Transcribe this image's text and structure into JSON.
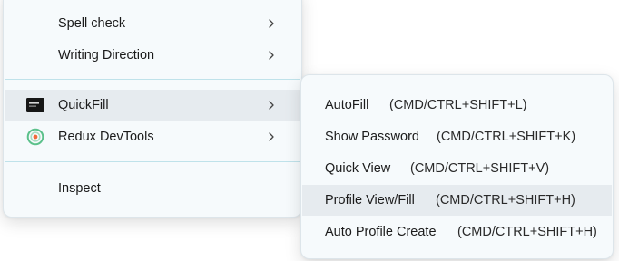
{
  "context_menu": {
    "items": [
      {
        "label": "Spell check",
        "has_submenu": true
      },
      {
        "label": "Writing Direction",
        "has_submenu": true
      },
      {
        "label": "QuickFill",
        "has_submenu": true,
        "icon": "quickfill-logo-icon",
        "highlighted": true
      },
      {
        "label": "Redux DevTools",
        "has_submenu": true,
        "icon": "redux-devtools-icon"
      },
      {
        "label": "Inspect",
        "has_submenu": false
      }
    ]
  },
  "quickfill_submenu": {
    "items": [
      {
        "label": "AutoFill",
        "shortcut": "(CMD/CTRL+SHIFT+L)"
      },
      {
        "label": "Show Password",
        "shortcut": "(CMD/CTRL+SHIFT+K)"
      },
      {
        "label": "Quick View",
        "shortcut": "(CMD/CTRL+SHIFT+V)"
      },
      {
        "label": "Profile View/Fill",
        "shortcut": "(CMD/CTRL+SHIFT+H)",
        "highlighted": true
      },
      {
        "label": "Auto Profile Create",
        "shortcut": "(CMD/CTRL+SHIFT+H)"
      }
    ]
  },
  "colors": {
    "menu_background": "#f6fafc",
    "highlight": "#e6ebef",
    "separator": "#bfe2ea",
    "redux_green": "#5cc18b",
    "redux_orange": "#f06a3a"
  }
}
